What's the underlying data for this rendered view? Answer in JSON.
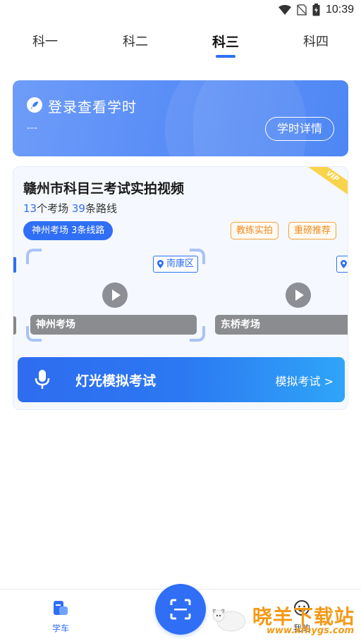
{
  "status_bar": {
    "time": "10:39"
  },
  "tabs": [
    {
      "label": "科一",
      "active": false
    },
    {
      "label": "科二",
      "active": false
    },
    {
      "label": "科三",
      "active": true
    },
    {
      "label": "科四",
      "active": false
    }
  ],
  "banner": {
    "title": "登录查看学时",
    "subtitle": "---",
    "button_label": "学时详情"
  },
  "card": {
    "title": "赣州市科目三考试实拍视频",
    "venues_count": "13",
    "venues_label": "个考场",
    "routes_count": "39",
    "routes_label": "条路线",
    "route_pill": "神州考场 3条线路",
    "vip_label": "VIP",
    "tags": [
      "教练实拍",
      "重磅推荐"
    ],
    "videos": [
      {
        "venue": "神州考场",
        "district": "南康区"
      },
      {
        "venue": "东桥考场",
        "district": ""
      }
    ]
  },
  "action": {
    "title": "灯光模拟考试",
    "link": "模拟考试 >"
  },
  "bottom_nav": {
    "items": [
      {
        "label": "学车",
        "icon": "car-learn-icon"
      },
      {
        "label": "我的",
        "icon": "profile-icon"
      }
    ],
    "center_icon": "scan-icon"
  },
  "watermark": {
    "text": "晓羊下载站",
    "url": "www.xfhygs.com"
  },
  "colors": {
    "primary": "#2f6ef5",
    "accent_orange": "#f08a1c",
    "vip_yellow": "#f8d44a"
  }
}
